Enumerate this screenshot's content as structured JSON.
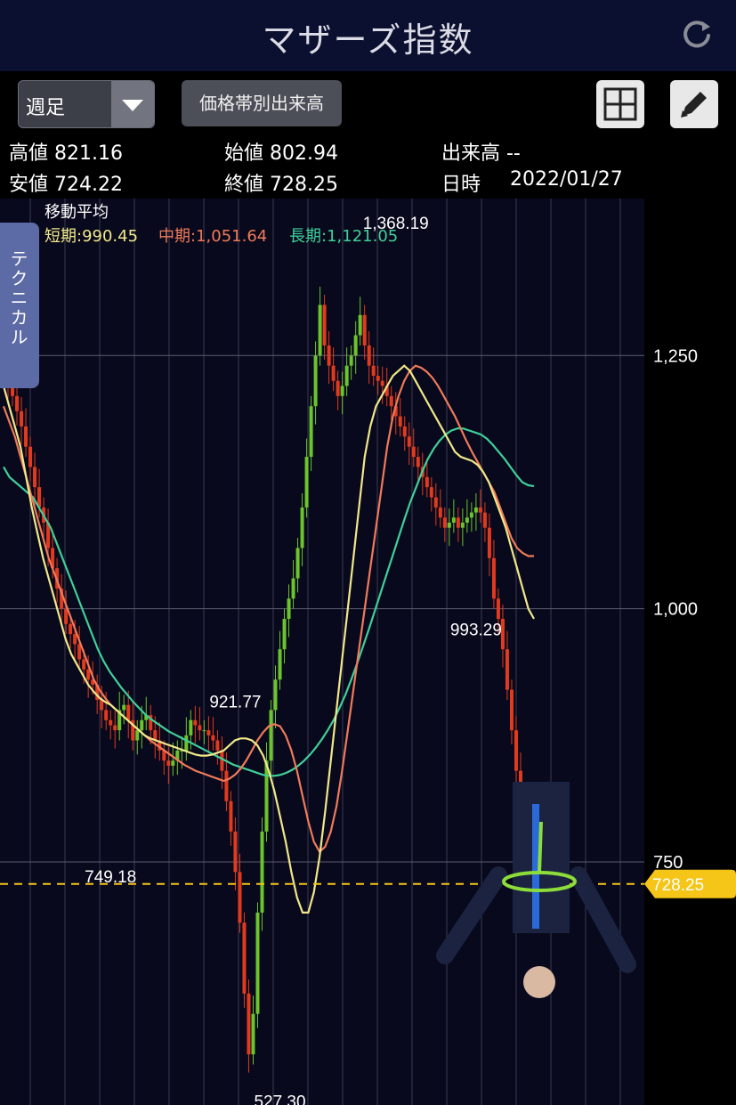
{
  "header": {
    "title": "マザーズ指数",
    "refresh_icon": "refresh-icon"
  },
  "toolbar": {
    "period_value": "週足",
    "volume_button": "価格帯別出来高",
    "layout_icon": "grid-icon",
    "draw_icon": "pencil-icon"
  },
  "stats": {
    "high": "高値 821.16",
    "open": "始値 802.94",
    "volume": "出来高 --",
    "low": "安値 724.22",
    "close": "終値 728.25",
    "date_label": "日時",
    "date_value": "2022/01/27"
  },
  "side_tab": {
    "label": "テクニカル"
  },
  "chart_data": {
    "type": "line",
    "legend_title": "移動平均",
    "legend": {
      "short": "短期:990.45",
      "mid": "中期:1,051.64",
      "long": "長期:1,121.05"
    },
    "colors": {
      "up": "#6cc42c",
      "down": "#e23a1f",
      "short": "#f0e88a",
      "mid": "#f07a5a",
      "long": "#3fd09a",
      "current": "#f5c518"
    },
    "y_ticks": [
      "1,250",
      "1,000",
      "750"
    ],
    "y_tick_values": [
      1250,
      1000,
      750
    ],
    "ylim": [
      510,
      1405
    ],
    "current_price_label": "728.25",
    "current_price": 728.25,
    "annotations": [
      {
        "text": "1,368.19",
        "x": 88,
        "y": 1368.19
      },
      {
        "text": "921.77",
        "x": 52,
        "y": 921.77
      },
      {
        "text": "993.29",
        "x": 106,
        "y": 993.29
      },
      {
        "text": "749.18",
        "x": 24,
        "y": 749.18
      },
      {
        "text": "527.30",
        "x": 62,
        "y": 527.3
      }
    ],
    "x_count": 120,
    "close": [
      1240,
      1225,
      1210,
      1195,
      1180,
      1160,
      1140,
      1120,
      1100,
      1085,
      1060,
      1040,
      1020,
      1000,
      985,
      975,
      965,
      950,
      940,
      930,
      925,
      910,
      900,
      890,
      885,
      880,
      900,
      905,
      890,
      870,
      880,
      890,
      895,
      880,
      870,
      860,
      850,
      845,
      850,
      860,
      860,
      875,
      890,
      885,
      880,
      880,
      875,
      870,
      860,
      840,
      810,
      780,
      740,
      690,
      620,
      560,
      600,
      700,
      780,
      850,
      900,
      930,
      960,
      990,
      1010,
      1030,
      1060,
      1100,
      1150,
      1200,
      1250,
      1300,
      1260,
      1240,
      1225,
      1210,
      1220,
      1240,
      1250,
      1270,
      1290,
      1260,
      1240,
      1230,
      1225,
      1220,
      1210,
      1200,
      1190,
      1180,
      1170,
      1160,
      1150,
      1140,
      1130,
      1120,
      1110,
      1100,
      1090,
      1080,
      1085,
      1090,
      1080,
      1085,
      1090,
      1095,
      1100,
      1095,
      1080,
      1050,
      1010,
      990,
      960,
      920,
      880,
      840,
      800,
      770,
      745,
      728
    ],
    "ma_short": [
      1220,
      1200,
      1180,
      1160,
      1130,
      1100,
      1075,
      1050,
      1030,
      1010,
      990,
      970,
      955,
      945,
      935,
      925,
      918,
      912,
      908,
      905,
      900,
      895,
      890,
      885,
      880,
      875,
      872,
      870,
      868,
      866,
      864,
      862,
      860,
      858,
      856,
      855,
      855,
      856,
      858,
      860,
      865,
      870,
      872,
      872,
      870,
      865,
      855,
      840,
      820,
      795,
      770,
      740,
      715,
      700,
      700,
      720,
      755,
      800,
      850,
      900,
      950,
      1000,
      1050,
      1100,
      1150,
      1180,
      1200,
      1210,
      1220,
      1230,
      1235,
      1240,
      1235,
      1225,
      1215,
      1205,
      1195,
      1185,
      1175,
      1165,
      1155,
      1150,
      1148,
      1146,
      1142,
      1135,
      1125,
      1110,
      1095,
      1080,
      1060,
      1040,
      1020,
      1000,
      990
    ],
    "ma_mid": [
      1200,
      1185,
      1170,
      1150,
      1130,
      1110,
      1090,
      1070,
      1050,
      1035,
      1020,
      1005,
      990,
      975,
      960,
      945,
      930,
      920,
      912,
      905,
      900,
      895,
      890,
      885,
      880,
      875,
      870,
      866,
      862,
      858,
      854,
      850,
      846,
      843,
      840,
      838,
      836,
      834,
      832,
      830,
      832,
      836,
      842,
      850,
      860,
      870,
      878,
      884,
      886,
      884,
      875,
      860,
      840,
      815,
      790,
      770,
      760,
      765,
      780,
      805,
      840,
      880,
      920,
      960,
      1000,
      1040,
      1080,
      1120,
      1160,
      1190,
      1210,
      1225,
      1235,
      1240,
      1238,
      1234,
      1228,
      1220,
      1210,
      1200,
      1190,
      1178,
      1166,
      1155,
      1145,
      1135,
      1125,
      1115,
      1100,
      1085,
      1070,
      1060,
      1055,
      1052,
      1052
    ],
    "ma_long": [
      1140,
      1130,
      1125,
      1120,
      1115,
      1110,
      1100,
      1090,
      1080,
      1065,
      1050,
      1035,
      1020,
      1005,
      990,
      975,
      960,
      948,
      938,
      930,
      922,
      915,
      908,
      902,
      896,
      891,
      887,
      883,
      879,
      876,
      873,
      870,
      867,
      864,
      861,
      858,
      855,
      852,
      849,
      846,
      844,
      842,
      840,
      838,
      836,
      835,
      835,
      836,
      838,
      841,
      845,
      850,
      856,
      863,
      871,
      880,
      890,
      902,
      915,
      930,
      946,
      963,
      980,
      998,
      1016,
      1034,
      1052,
      1070,
      1088,
      1105,
      1120,
      1135,
      1148,
      1158,
      1166,
      1172,
      1176,
      1178,
      1178,
      1176,
      1174,
      1172,
      1168,
      1162,
      1155,
      1148,
      1140,
      1132,
      1125,
      1122,
      1121
    ]
  }
}
